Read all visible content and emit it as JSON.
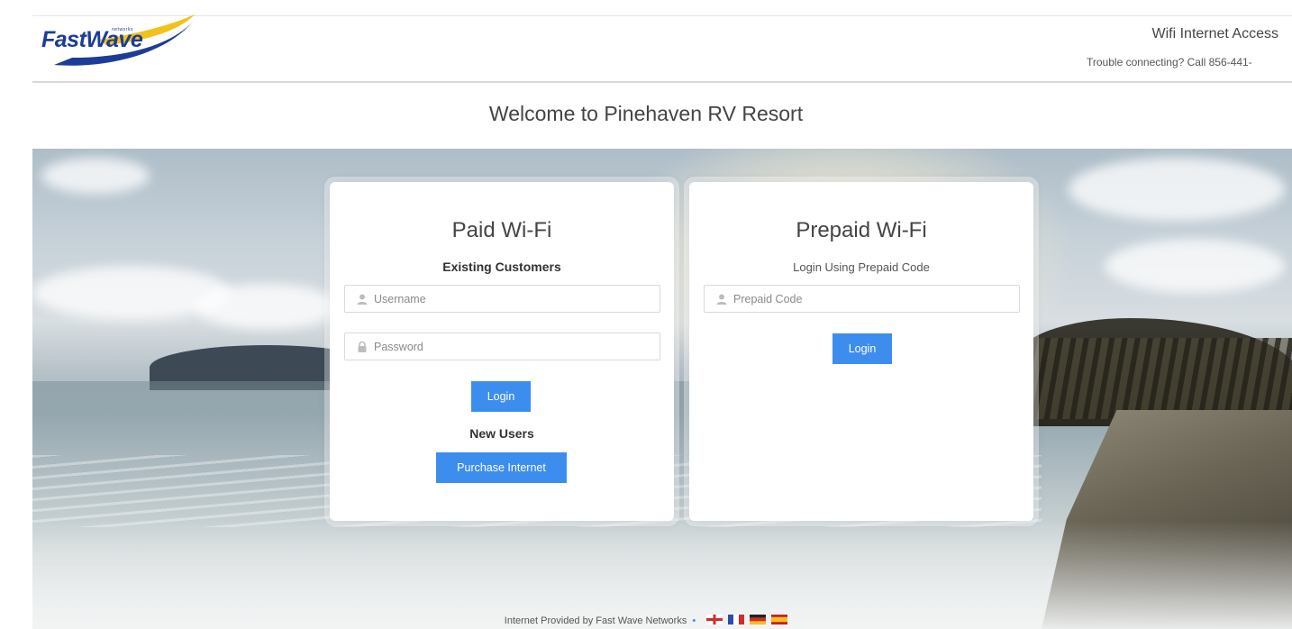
{
  "header": {
    "logo_text_fast": "Fast",
    "logo_text_wave": "Wave",
    "logo_subtext": "networks",
    "title": "Wifi Internet Access",
    "trouble_text": "Trouble connecting? Call 856-441-"
  },
  "welcome": "Welcome to Pinehaven RV Resort",
  "paid": {
    "title": "Paid Wi-Fi",
    "existing_label": "Existing Customers",
    "username_placeholder": "Username",
    "password_placeholder": "Password",
    "login_label": "Login",
    "new_users_label": "New Users",
    "purchase_label": "Purchase Internet"
  },
  "prepaid": {
    "title": "Prepaid Wi-Fi",
    "subtitle": "Login Using Prepaid Code",
    "code_placeholder": "Prepaid Code",
    "login_label": "Login"
  },
  "footer": {
    "text": "Internet Provided by Fast Wave Networks",
    "separator": "•",
    "languages": [
      "english-flag",
      "french-flag",
      "german-flag",
      "spanish-flag"
    ]
  },
  "colors": {
    "accent": "#3d8def",
    "logo_blue": "#1c3c98",
    "logo_yellow": "#f2c21b"
  }
}
